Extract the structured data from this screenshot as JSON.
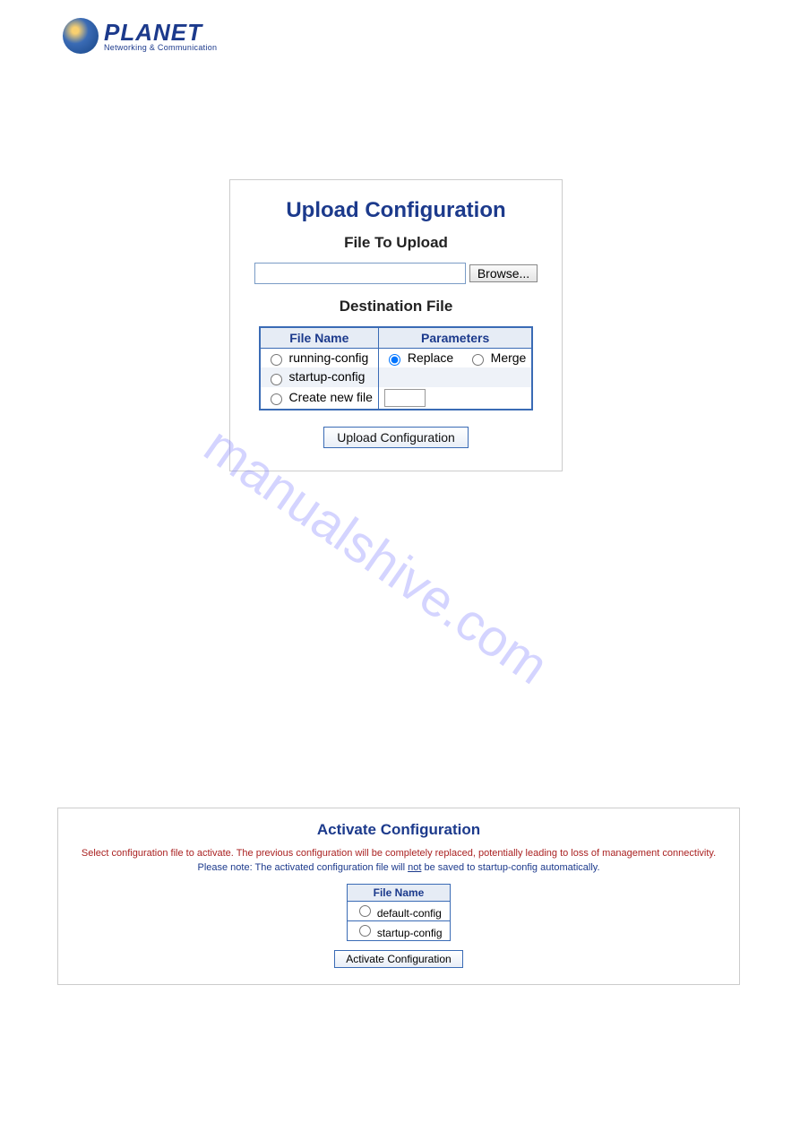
{
  "logo": {
    "name": "PLANET",
    "tagline": "Networking & Communication"
  },
  "upload": {
    "title": "Upload Configuration",
    "subtitle_file": "File To Upload",
    "browse_label": "Browse...",
    "subtitle_dest": "Destination File",
    "headers": {
      "filename": "File Name",
      "parameters": "Parameters"
    },
    "rows": {
      "running": "running-config",
      "startup": "startup-config",
      "createnew": "Create new file"
    },
    "params": {
      "replace": "Replace",
      "merge": "Merge"
    },
    "button": "Upload Configuration"
  },
  "activate": {
    "title": "Activate Configuration",
    "warn": "Select configuration file to activate. The previous configuration will be completely replaced, potentially leading to loss of management connectivity.",
    "note_pre": "Please note: The activated configuration file will ",
    "note_underlined": "not",
    "note_post": " be saved to startup-config automatically.",
    "header": "File Name",
    "rows": {
      "default": "default-config",
      "startup": "startup-config"
    },
    "button": "Activate Configuration"
  },
  "watermark": "manualshive.com"
}
